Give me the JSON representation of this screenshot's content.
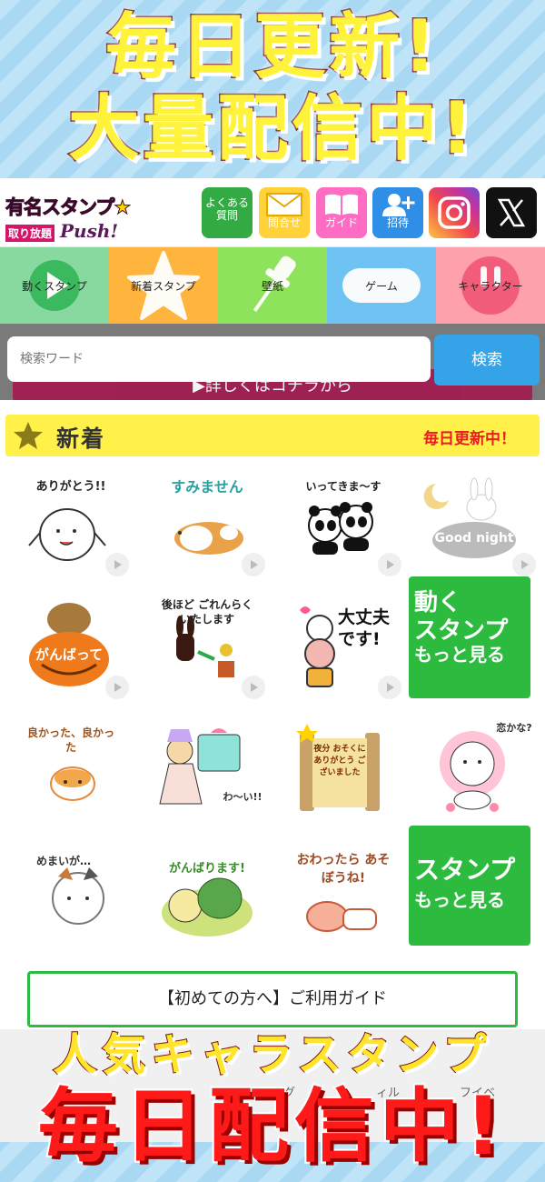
{
  "promo": {
    "headline1": "毎日更新!",
    "headline2": "大量配信中!",
    "headline3": "人気キャラスタンプ",
    "headline4": "毎日配信中!"
  },
  "logo": {
    "line1": "有名スタンプ",
    "star": "★",
    "line2": "取り放題",
    "line3": "Push!"
  },
  "header_buttons": [
    {
      "label": "よくある\n質問",
      "icon": "question-icon",
      "color": "#33aa44"
    },
    {
      "label": "問合せ",
      "icon": "envelope-icon",
      "color": "#ffd23a"
    },
    {
      "label": "ガイド",
      "icon": "book-icon",
      "color": "#ff6cc3"
    },
    {
      "label": "招待",
      "icon": "add-user-icon",
      "color": "#2f8fe6"
    },
    {
      "label": "",
      "icon": "instagram-icon",
      "color": "#c3339e"
    },
    {
      "label": "",
      "icon": "x-icon",
      "color": "#111111"
    }
  ],
  "nav": [
    {
      "label": "動くスタンプ",
      "icon": "play-circle-icon",
      "color": "#88d9a0"
    },
    {
      "label": "新着スタンプ",
      "icon": "star-icon",
      "color": "#ffb53d"
    },
    {
      "label": "壁紙",
      "icon": "pin-icon",
      "color": "#8fe35c"
    },
    {
      "label": "ゲーム",
      "icon": "gamepad-icon",
      "color": "#6ec3f2"
    },
    {
      "label": "キャラクター",
      "icon": "character-icon",
      "color": "#ffa0ad"
    }
  ],
  "search": {
    "placeholder": "検索ワード",
    "button": "検索",
    "banner_under": "▶詳しくはコチラから"
  },
  "new_section": {
    "title": "新着",
    "subtitle": "毎日更新中！"
  },
  "stickers": [
    {
      "text": "ありがとう!!",
      "animated": true
    },
    {
      "text": "すみません",
      "animated": true
    },
    {
      "text": "いってきま～す",
      "animated": true
    },
    {
      "text": "Good night",
      "animated": true
    },
    {
      "text": "がんばって",
      "animated": true
    },
    {
      "text": "後ほど ごれんらく いたします",
      "animated": true
    },
    {
      "text": "大丈夫です!",
      "animated": true
    },
    {
      "text": "良かった、良かった",
      "animated": false
    },
    {
      "text": "わ～い!!",
      "animated": false
    },
    {
      "text": "夜分 おそくに ありがとう ございました",
      "animated": false
    },
    {
      "text": "恋かな?",
      "animated": false
    },
    {
      "text": "めまいが…",
      "animated": false
    },
    {
      "text": "がんばります!",
      "animated": false
    },
    {
      "text": "おわったら あそぼうね!",
      "animated": false
    }
  ],
  "more_buttons": {
    "animated": {
      "line1": "動く",
      "line2": "スタンプ",
      "line3": "もっと見る"
    },
    "stamps": {
      "line1": "スタンプ",
      "line2": "もっと見る"
    }
  },
  "guide": {
    "label": "【初めての方へ】ご利用ガイド"
  },
  "bottom_tabs": [
    "グ",
    "ィル",
    "フイベ"
  ],
  "colors": {
    "accent_green": "#2dbb3f",
    "search_blue": "#35a3e8",
    "headline_yellow": "#fff23a",
    "headline_red": "#ff1a1a",
    "new_bar": "#fff04a"
  }
}
